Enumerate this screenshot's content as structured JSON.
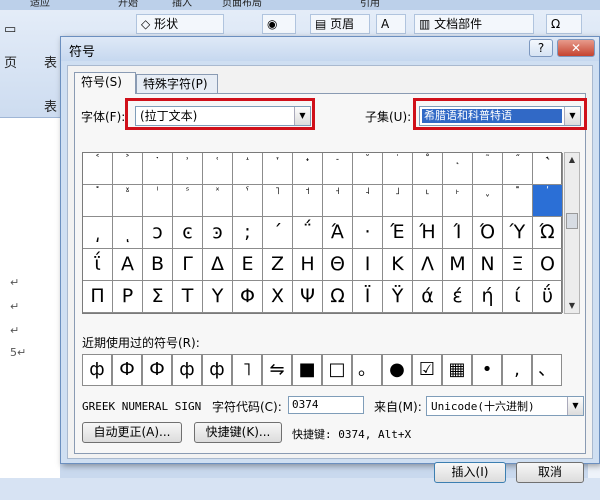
{
  "background": {
    "ribbon_tabs": [
      "适应",
      "开始",
      "插入",
      "页面布局",
      "引用"
    ],
    "shapes_label": "形状",
    "header_label": "页眉",
    "doc_parts_label": "文档部件",
    "page_label": "页",
    "table_label": "表",
    "doc_marks": [
      "↵",
      "↵",
      "↵",
      "5↵"
    ]
  },
  "dialog": {
    "title": "符号",
    "help": "?",
    "close": "✕",
    "tabs": [
      "符号(S)",
      "特殊字符(P)"
    ],
    "font_label": "字体(F):",
    "font_value": "(拉丁文本)",
    "subset_label": "子集(U):",
    "subset_value": "希腊语和科普特语",
    "grid": [
      [
        "˂",
        "˃",
        "ˑ",
        "˒",
        "˓",
        "˔",
        "˕",
        "˖",
        "˗",
        "˘",
        "˙",
        "˚",
        "˛",
        "˜",
        "˝",
        "˞"
      ],
      [
        "˟",
        "ˠ",
        "ˡ",
        "ˢ",
        "ˣ",
        "ˤ",
        "˥",
        "˦",
        "˧",
        "˨",
        "˩",
        "˪",
        "˫",
        "ˬ",
        "˭",
        "ʹ"
      ],
      [
        "͵",
        "ͺ",
        "ͻ",
        "ͼ",
        "ͽ",
        ";",
        "΄",
        "΅",
        "Ά",
        "·",
        "Έ",
        "Ή",
        "Ί",
        "Ό",
        "Ύ",
        "Ώ"
      ],
      [
        "ΐ",
        "Α",
        "Β",
        "Γ",
        "Δ",
        "Ε",
        "Ζ",
        "Η",
        "Θ",
        "Ι",
        "Κ",
        "Λ",
        "Μ",
        "Ν",
        "Ξ",
        "Ο"
      ],
      [
        "Π",
        "Ρ",
        "Σ",
        "Τ",
        "Υ",
        "Φ",
        "Χ",
        "Ψ",
        "Ω",
        "Ϊ",
        "Ϋ",
        "ά",
        "έ",
        "ή",
        "ί",
        "ΰ"
      ]
    ],
    "selected_index": 31,
    "recent_label": "近期使用过的符号(R):",
    "recent": [
      "ф",
      "Ф",
      "Ф",
      "ф",
      "ф",
      "˥",
      "⇋",
      "■",
      "□",
      "。",
      "●",
      "☑",
      "▦",
      "•",
      ",",
      "、"
    ],
    "char_name": "GREEK NUMERAL SIGN",
    "char_code_label": "字符代码(C):",
    "char_code_value": "0374",
    "from_label": "来自(M):",
    "from_value": "Unicode(十六进制)",
    "autocorrect_button": "自动更正(A)...",
    "shortcut_key_button": "快捷键(K)...",
    "shortcut_text": "快捷键: 0374, Alt+X",
    "insert_button": "插入(I)",
    "cancel_button": "取消"
  }
}
